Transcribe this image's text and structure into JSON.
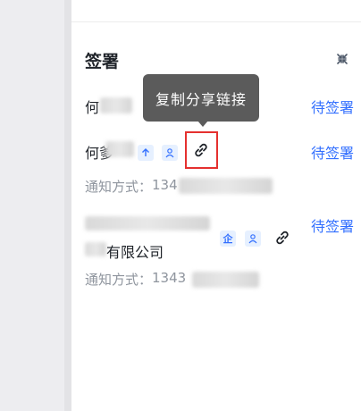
{
  "panel": {
    "title": "签署"
  },
  "tooltip": {
    "text": "复制分享链接"
  },
  "signers": [
    {
      "name_prefix": "何",
      "status": "待签署"
    },
    {
      "name_prefix": "何爹",
      "status": "待签署",
      "badges": [
        "个人",
        "经办人"
      ],
      "notify_label": "通知方式：",
      "notify_value": "134"
    },
    {
      "company_suffix": "有限公司",
      "status": "待签署",
      "badges": [
        "企",
        "经办人"
      ],
      "notify_label": "通知方式：",
      "notify_value": "1343"
    }
  ],
  "icons": {
    "collapse": "collapse-icon",
    "link": "link-icon",
    "badge_person": "person-icon",
    "badge_up": "up-arrow-icon"
  },
  "colors": {
    "accent": "#3370ff",
    "highlight": "#e5312f",
    "tooltip_bg": "#5b5b5b"
  }
}
